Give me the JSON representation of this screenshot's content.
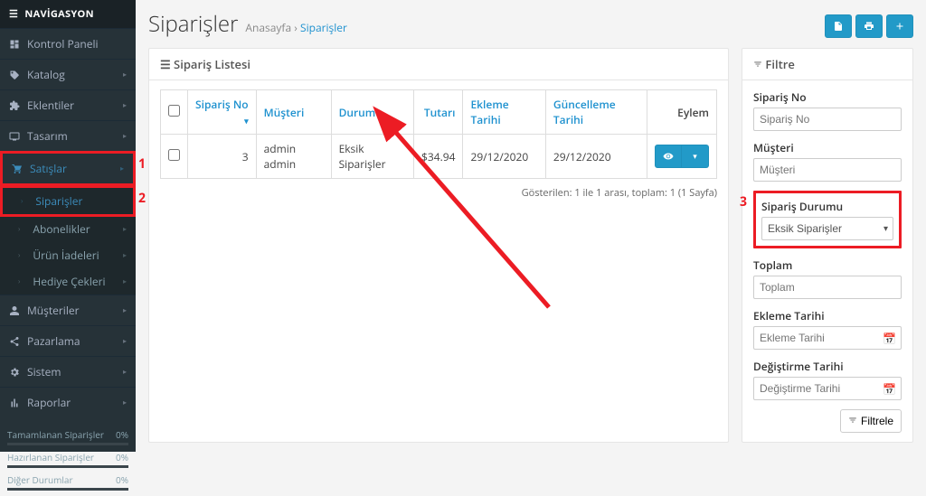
{
  "sidebar": {
    "title": "NAVİGASYON",
    "items": [
      {
        "icon": "dashboard",
        "label": "Kontrol Paneli",
        "expand": false
      },
      {
        "icon": "tag",
        "label": "Katalog",
        "expand": true
      },
      {
        "icon": "puzzle",
        "label": "Eklentiler",
        "expand": true
      },
      {
        "icon": "tv",
        "label": "Tasarım",
        "expand": true
      },
      {
        "icon": "cart",
        "label": "Satışlar",
        "expand": true,
        "hl": 1,
        "sub": [
          {
            "label": "Siparişler",
            "active": true,
            "hl": 2
          },
          {
            "label": "Abonelikler",
            "expand": true
          },
          {
            "label": "Ürün İadeleri",
            "expand": true
          },
          {
            "label": "Hediye Çekleri",
            "expand": true
          }
        ]
      },
      {
        "icon": "user",
        "label": "Müşteriler",
        "expand": true
      },
      {
        "icon": "share",
        "label": "Pazarlama",
        "expand": true
      },
      {
        "icon": "gear",
        "label": "Sistem",
        "expand": true
      },
      {
        "icon": "chart",
        "label": "Raporlar",
        "expand": true
      }
    ],
    "stats": [
      {
        "label": "Tamamlanan Siparişler",
        "pct": "0%"
      },
      {
        "label": "Hazırlanan Siparişler",
        "pct": "0%"
      },
      {
        "label": "Diğer Durumlar",
        "pct": "0%"
      }
    ]
  },
  "page": {
    "title": "Siparişler",
    "breadcrumb_home": "Anasayfa",
    "breadcrumb_sep": " › ",
    "breadcrumb_cur": "Siparişler"
  },
  "orderList": {
    "panelTitle": "Sipariş Listesi",
    "cols": {
      "id": "Sipariş No",
      "customer": "Müşteri",
      "status": "Durumu",
      "total": "Tutarı",
      "added": "Ekleme Tarihi",
      "modified": "Güncelleme Tarihi",
      "action": "Eylem"
    },
    "rows": [
      {
        "id": "3",
        "customer": "admin admin",
        "status": "Eksik Siparişler",
        "total": "$34.94",
        "added": "29/12/2020",
        "modified": "29/12/2020"
      }
    ],
    "pager": "Gösterilen: 1 ile 1 arası, toplam: 1 (1 Sayfa)"
  },
  "filter": {
    "title": "Filtre",
    "orderId": {
      "label": "Sipariş No",
      "ph": "Sipariş No"
    },
    "customer": {
      "label": "Müşteri",
      "ph": "Müşteri"
    },
    "status": {
      "label": "Sipariş Durumu",
      "value": "Eksik Siparişler",
      "hl": 3
    },
    "total": {
      "label": "Toplam",
      "ph": "Toplam"
    },
    "added": {
      "label": "Ekleme Tarihi",
      "ph": "Ekleme Tarihi"
    },
    "modified": {
      "label": "Değiştirme Tarihi",
      "ph": "Değiştirme Tarihi"
    },
    "btn": "Filtrele"
  }
}
